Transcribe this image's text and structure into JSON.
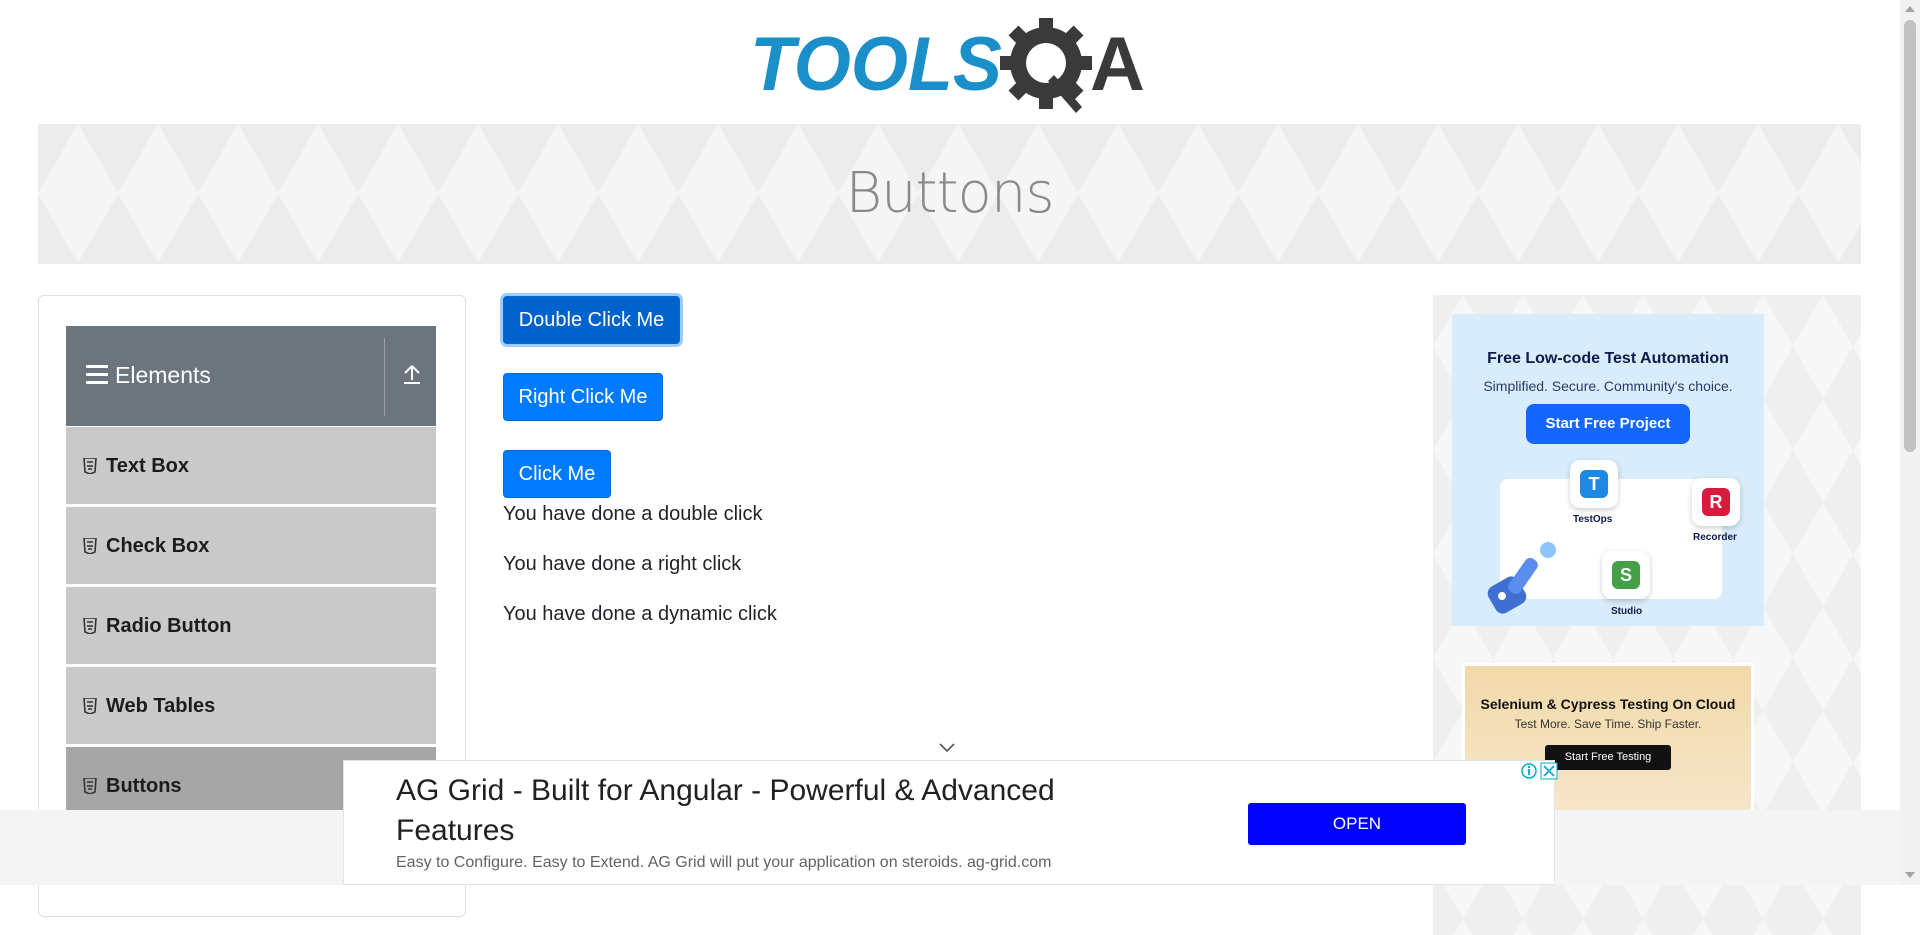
{
  "header": {
    "logo_text_left": "TOOLS",
    "logo_text_right": "A",
    "page_title": "Buttons"
  },
  "sidebar": {
    "group_title": "Elements",
    "items": [
      {
        "label": "Text Box",
        "active": false
      },
      {
        "label": "Check Box",
        "active": false
      },
      {
        "label": "Radio Button",
        "active": false
      },
      {
        "label": "Web Tables",
        "active": false
      },
      {
        "label": "Buttons",
        "active": true
      }
    ]
  },
  "main": {
    "double_click_label": "Double Click Me",
    "right_click_label": "Right Click Me",
    "click_label": "Click Me",
    "double_click_message": "You have done a double click",
    "right_click_message": "You have done a right click",
    "dynamic_click_message": "You have done a dynamic click"
  },
  "right_ads": {
    "ad1": {
      "headline": "Free Low-code Test Automation",
      "subline": "Simplified. Secure. Community's choice.",
      "cta": "Start Free Project",
      "tiles": [
        {
          "letter": "T",
          "label": "TestOps",
          "color": "#1e88e5"
        },
        {
          "letter": "R",
          "label": "Recorder",
          "color": "#d81b3c"
        },
        {
          "letter": "S",
          "label": "Studio",
          "color": "#43a047"
        }
      ]
    },
    "ad2": {
      "headline": "Selenium & Cypress Testing On Cloud",
      "subline": "Test More. Save Time. Ship Faster.",
      "cta": "Start Free Testing"
    }
  },
  "bottom_ad": {
    "title": "AG Grid - Built for Angular - Powerful & Advanced Features",
    "description": "Easy to Configure. Easy to Extend. AG Grid will put your application on steroids. ag-grid.com",
    "button": "OPEN"
  },
  "colors": {
    "primary": "#007bff",
    "sidebar_header": "#6c757d",
    "sidebar_item": "#c9c9c9",
    "sidebar_item_active": "#a6a6a6",
    "logo_blue": "#1a8fc9",
    "logo_dark": "#3a3a3a",
    "ad_button": "#0000ff"
  }
}
